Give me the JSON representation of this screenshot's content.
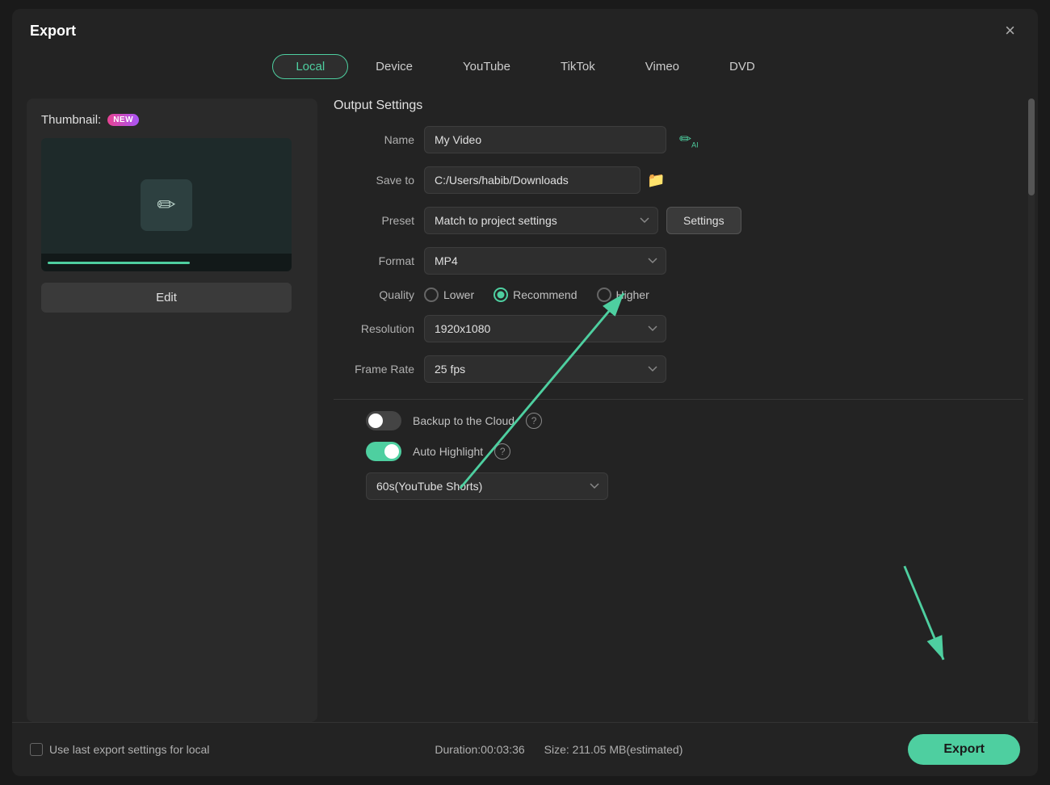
{
  "dialog": {
    "title": "Export",
    "close_label": "×"
  },
  "tabs": [
    {
      "id": "local",
      "label": "Local",
      "active": true
    },
    {
      "id": "device",
      "label": "Device",
      "active": false
    },
    {
      "id": "youtube",
      "label": "YouTube",
      "active": false
    },
    {
      "id": "tiktok",
      "label": "TikTok",
      "active": false
    },
    {
      "id": "vimeo",
      "label": "Vimeo",
      "active": false
    },
    {
      "id": "dvd",
      "label": "DVD",
      "active": false
    }
  ],
  "left_panel": {
    "thumbnail_label": "Thumbnail:",
    "new_badge": "NEW",
    "edit_button": "Edit"
  },
  "output_settings": {
    "section_title": "Output Settings",
    "name_label": "Name",
    "name_value": "My Video",
    "save_to_label": "Save to",
    "save_to_value": "C:/Users/habib/Downloads",
    "preset_label": "Preset",
    "preset_value": "Match to project settings",
    "settings_button": "Settings",
    "format_label": "Format",
    "format_value": "MP4",
    "quality_label": "Quality",
    "quality_options": [
      "Lower",
      "Recommend",
      "Higher"
    ],
    "quality_selected": "Recommend",
    "resolution_label": "Resolution",
    "resolution_value": "1920x1080",
    "frame_rate_label": "Frame Rate",
    "frame_rate_value": "25 fps",
    "backup_label": "Backup to the Cloud",
    "backup_enabled": false,
    "auto_highlight_label": "Auto Highlight",
    "auto_highlight_enabled": true,
    "highlight_value": "60s(YouTube Shorts)"
  },
  "bottom_bar": {
    "checkbox_label": "Use last export settings for local",
    "duration_label": "Duration:00:03:36",
    "size_label": "Size: 211.05 MB(estimated)",
    "export_button": "Export"
  }
}
